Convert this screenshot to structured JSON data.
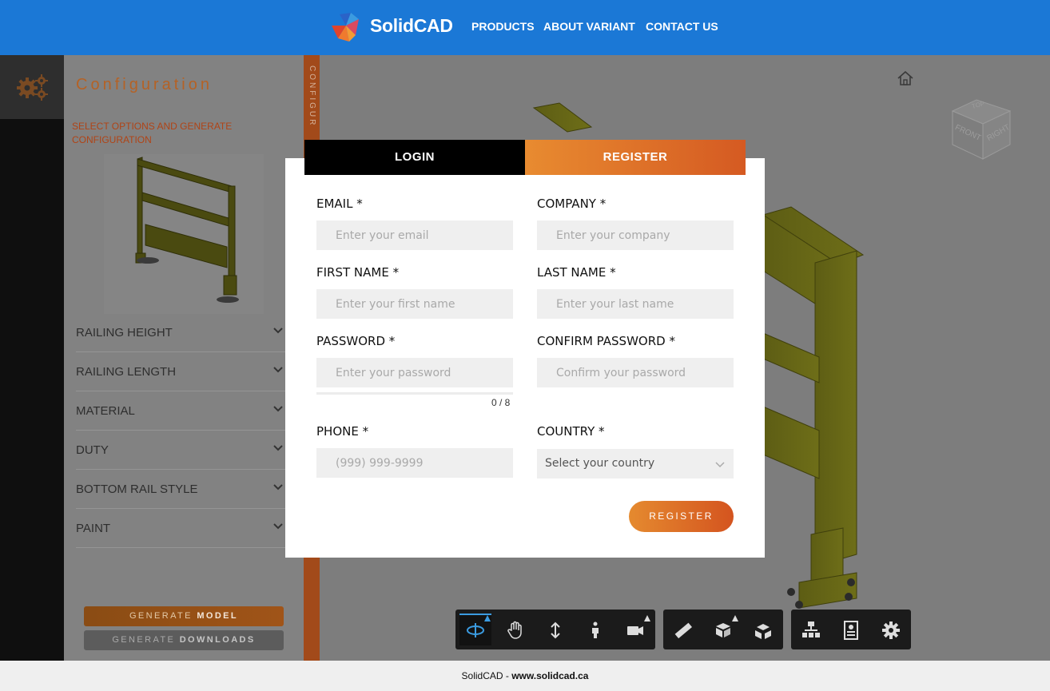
{
  "header": {
    "brand": "SolidCAD",
    "nav": [
      "PRODUCTS",
      "ABOUT VARIANT",
      "CONTACT US"
    ]
  },
  "sidebar": {
    "title": "Configuration",
    "subtitle": "SELECT OPTIONS AND GENERATE CONFIGURATION",
    "vertical_tab": "CONFIGUR",
    "options": [
      "RAILING HEIGHT",
      "RAILING LENGTH",
      "MATERIAL",
      "DUTY",
      "BOTTOM RAIL STYLE",
      "PAINT"
    ],
    "generate_model": {
      "prefix": "GENERATE ",
      "bold": "MODEL"
    },
    "generate_downloads": {
      "prefix": "GENERATE ",
      "bold": "DOWNLOADS"
    }
  },
  "viewcube": {
    "top": "TOP",
    "front": "FRONT",
    "right": "RIGHT"
  },
  "modal": {
    "tabs": {
      "login": "LOGIN",
      "register": "REGISTER"
    },
    "fields": {
      "email": {
        "label": "EMAIL *",
        "placeholder": "Enter your email"
      },
      "company": {
        "label": "COMPANY *",
        "placeholder": "Enter your company"
      },
      "first_name": {
        "label": "FIRST NAME *",
        "placeholder": "Enter your first name"
      },
      "last_name": {
        "label": "LAST NAME *",
        "placeholder": "Enter your last name"
      },
      "password": {
        "label": "PASSWORD *",
        "placeholder": "Enter your password",
        "counter": "0 / 8"
      },
      "confirm_password": {
        "label": "CONFIRM PASSWORD *",
        "placeholder": "Confirm your password"
      },
      "phone": {
        "label": "PHONE *",
        "placeholder": "(999) 999-9999"
      },
      "country": {
        "label": "COUNTRY *",
        "value": "Select your country"
      }
    },
    "submit": "REGISTER"
  },
  "footer": {
    "prefix": "SolidCAD - ",
    "link": "www.solidcad.ca"
  },
  "colors": {
    "brand_blue": "#1b78d6",
    "accent_orange": "#e07a2c",
    "model_yellow": "#caca2c"
  }
}
